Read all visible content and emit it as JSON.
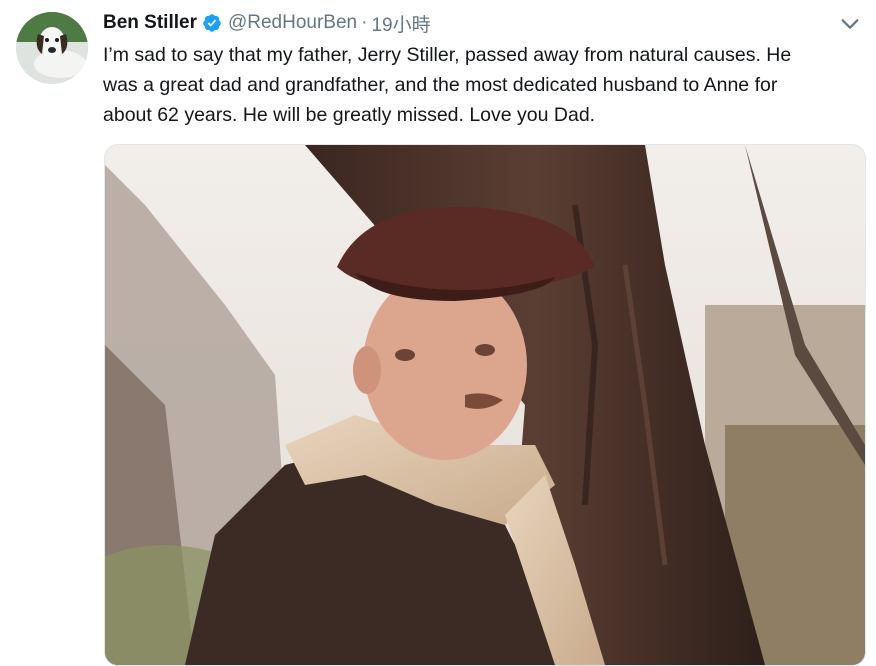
{
  "tweet": {
    "author_name": "Ben Stiller",
    "verified": true,
    "handle": "@RedHourBen",
    "separator": "·",
    "timestamp": "19小時",
    "text_lines": [
      "I’m sad to say that my father, Jerry Stiller, passed away from natural causes. He",
      "was a great dad and grandfather,  and the most dedicated husband to Anne for",
      "about 62 years. He will be greatly missed. Love you Dad."
    ]
  },
  "icons": {
    "verified": "verified-badge-icon",
    "more": "chevron-down-icon"
  },
  "colors": {
    "verified_blue": "#1da1f2",
    "secondary_text": "#657786",
    "primary_text": "#14171a",
    "border": "#e1e8ed"
  }
}
